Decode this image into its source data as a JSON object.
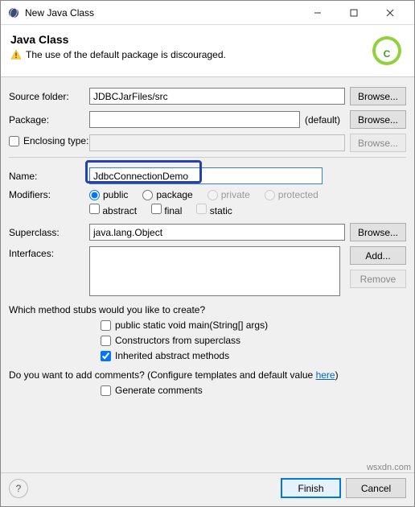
{
  "titlebar": {
    "title": "New Java Class"
  },
  "header": {
    "title": "Java Class",
    "warning": "The use of the default package is discouraged."
  },
  "form": {
    "sourceFolder": {
      "label": "Source folder:",
      "value": "JDBCJarFiles/src",
      "browse": "Browse..."
    },
    "package": {
      "label": "Package:",
      "value": "",
      "default": "(default)",
      "browse": "Browse..."
    },
    "enclosingType": {
      "label": "Enclosing type:",
      "value": "",
      "browse": "Browse..."
    },
    "name": {
      "label": "Name:",
      "value": "JdbcConnectionDemo"
    },
    "modifiers": {
      "label": "Modifiers:",
      "public": "public",
      "package": "package",
      "private": "private",
      "protected": "protected",
      "abstract": "abstract",
      "final": "final",
      "static": "static"
    },
    "superclass": {
      "label": "Superclass:",
      "value": "java.lang.Object",
      "browse": "Browse..."
    },
    "interfaces": {
      "label": "Interfaces:",
      "add": "Add...",
      "remove": "Remove"
    }
  },
  "stubs": {
    "question": "Which method stubs would you like to create?",
    "main": "public static void main(String[] args)",
    "constructors": "Constructors from superclass",
    "inherited": "Inherited abstract methods"
  },
  "comments": {
    "question_prefix": "Do you want to add comments? (Configure templates and default value ",
    "link": "here",
    "question_suffix": ")",
    "generate": "Generate comments"
  },
  "footer": {
    "help": "?",
    "finish": "Finish",
    "cancel": "Cancel"
  },
  "watermark": "wsxdn.com"
}
